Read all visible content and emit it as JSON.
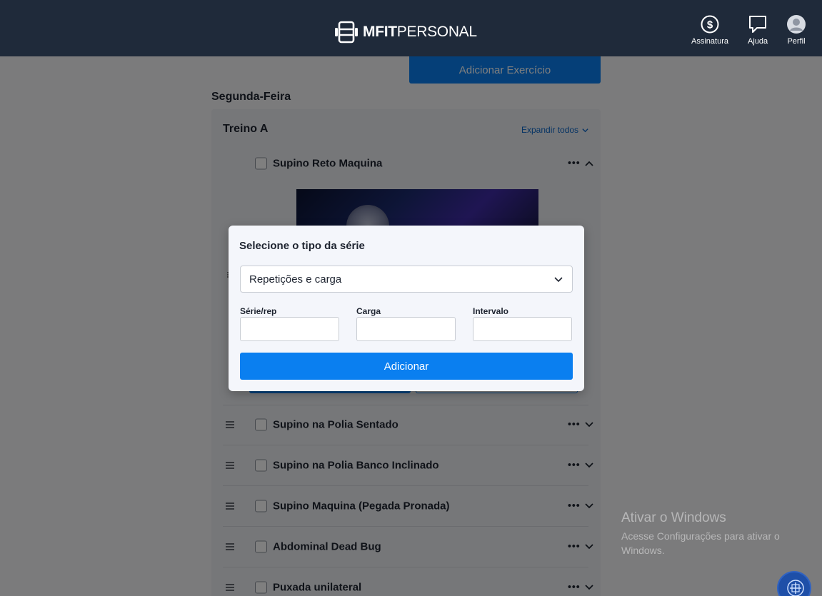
{
  "header": {
    "logo_bold": "MFIT",
    "logo_light": "PERSONAL",
    "nav": [
      {
        "label": "Assinatura",
        "icon": "dollar-circle-icon"
      },
      {
        "label": "Ajuda",
        "icon": "chat-bubble-icon"
      },
      {
        "label": "Perfil",
        "icon": "user-avatar-icon"
      }
    ]
  },
  "main": {
    "add_exercise_label": "Adicionar Exercício",
    "day_title": "Segunda-Feira",
    "workout_title": "Treino A",
    "expand_all_label": "Expandir todos",
    "exercises": [
      {
        "name": "Supino Reto Maquina",
        "expanded": true
      },
      {
        "name": "Supino na Polia Sentado",
        "expanded": false
      },
      {
        "name": "Supino na Polia Banco Inclinado",
        "expanded": false
      },
      {
        "name": "Supino Maquina (Pegada Pronada)",
        "expanded": false
      },
      {
        "name": "Abdominal Dead Bug",
        "expanded": false
      },
      {
        "name": "Puxada unilateral",
        "expanded": false
      }
    ],
    "more_glyph": "•••"
  },
  "modal": {
    "title": "Selecione o tipo da série",
    "select_value": "Repetições e carga",
    "fields": [
      {
        "label": "Série/rep",
        "value": ""
      },
      {
        "label": "Carga",
        "value": ""
      },
      {
        "label": "Intervalo",
        "value": ""
      }
    ],
    "add_label": "Adicionar"
  },
  "watermark": {
    "title": "Ativar o Windows",
    "subtitle": "Acesse Configurações para ativar o Windows."
  },
  "colors": {
    "header_bg": "#1f2a3a",
    "primary": "#0a7ff0",
    "link": "#0a66c8"
  }
}
